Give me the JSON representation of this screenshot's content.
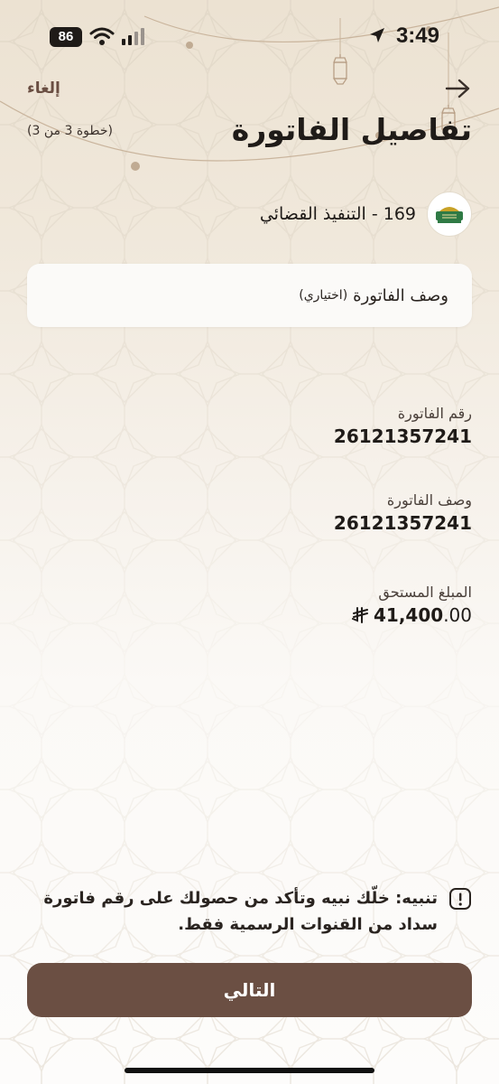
{
  "status_bar": {
    "time": "3:49",
    "battery": "86"
  },
  "header": {
    "cancel_label": "إلغاء",
    "title": "تفاصيل الفاتورة",
    "step_label": "(خطوة 3 من 3)"
  },
  "biller": {
    "name": "169 - التنفيذ القضائي",
    "logo_icon": "judiciary-logo-icon"
  },
  "description_input": {
    "placeholder": "وصف الفاتورة",
    "optional_label": "(اختياري)"
  },
  "fields": [
    {
      "label": "رقم الفاتورة",
      "value": "26121357241"
    },
    {
      "label": "وصف الفاتورة",
      "value": "26121357241"
    }
  ],
  "amount": {
    "label": "المبلغ المستحق",
    "integer": "41,400",
    "decimal": ".00",
    "currency_icon": "riyal-symbol-icon"
  },
  "warning": {
    "text": "تنبيه: خلّك نبيه وتأكد من حصولك على رقم فاتورة سداد من القنوات الرسمية فقط."
  },
  "next_button": {
    "label": "التالي"
  },
  "colors": {
    "primary": "#6b4f43",
    "accent_text": "#6a4e42",
    "background_top": "#ece2d2",
    "background_bottom": "#fdfcfb"
  }
}
